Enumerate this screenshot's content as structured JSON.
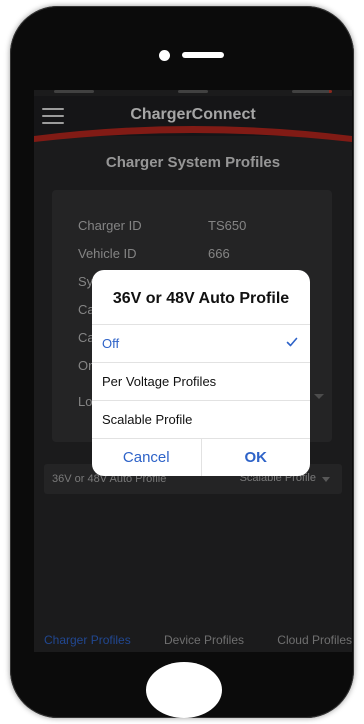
{
  "app": {
    "title": "ChargerConnect",
    "page_title": "Charger System Profiles"
  },
  "info_card": {
    "rows": [
      {
        "label": "Charger ID",
        "value": "TS650"
      },
      {
        "label": "Vehicle ID",
        "value": "666"
      },
      {
        "label": "Sy",
        "value": ""
      },
      {
        "label": "Ca",
        "value": ""
      },
      {
        "label": "Ca",
        "value": ""
      },
      {
        "label": "Or",
        "value": ""
      },
      {
        "label": "Lo",
        "value": ""
      }
    ]
  },
  "setting": {
    "label": "36V or 48V Auto Profile",
    "value": "Scalable Profile"
  },
  "tabs": [
    {
      "label": "Charger Profiles",
      "active": true
    },
    {
      "label": "Device Profiles",
      "active": false
    },
    {
      "label": "Cloud Profiles",
      "active": false
    }
  ],
  "dialog": {
    "title": "36V or 48V Auto Profile",
    "options": [
      {
        "label": "Off",
        "selected": true
      },
      {
        "label": "Per Voltage Profiles",
        "selected": false
      },
      {
        "label": "Scalable Profile",
        "selected": false
      }
    ],
    "cancel_label": "Cancel",
    "ok_label": "OK"
  },
  "colors": {
    "accent": "#2e63c8",
    "brand_red": "#b3261e",
    "screen_bg": "#262628",
    "card_bg": "#323234"
  },
  "icons": {
    "menu": "hamburger-menu-icon",
    "check": "check-icon",
    "dropdown": "chevron-down-icon"
  }
}
